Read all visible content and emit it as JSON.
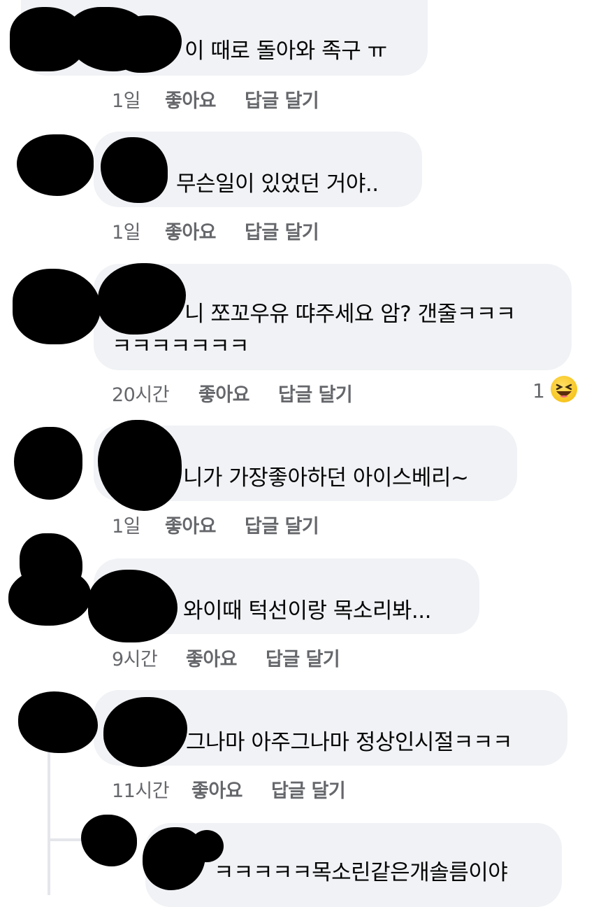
{
  "comments": [
    {
      "text": "이 때로 돌아와 족구 ㅠ",
      "time": "1일",
      "like": "좋아요",
      "reply": "답글 달기"
    },
    {
      "text": "무슨일이 있었던 거야..",
      "time": "1일",
      "like": "좋아요",
      "reply": "답글 달기"
    },
    {
      "text_line1": "니 쪼꼬우유 땨주세요 암? 갠줄ㅋㅋㅋ",
      "text_line2": "ㅋㅋㅋㅋㅋㅋㅋ",
      "time": "20시간",
      "like": "좋아요",
      "reply": "답글 달기",
      "reaction_count": "1",
      "reaction_icon": "laughing-emoji-icon"
    },
    {
      "text": "니가 가장좋아하던 아이스베리~",
      "time": "1일",
      "like": "좋아요",
      "reply": "답글 달기"
    },
    {
      "text": "와이때 턱선이랑 목소리봐...",
      "time": "9시간",
      "like": "좋아요",
      "reply": "답글 달기"
    },
    {
      "text": "그나마 아주그나마 정상인시절ㅋㅋㅋ",
      "time": "11시간",
      "like": "좋아요",
      "reply": "답글 달기"
    },
    {
      "text": "ㅋㅋㅋㅋㅋ목소린같은개솔름이야",
      "is_reply": true
    }
  ],
  "colors": {
    "bubble": "#f0f2f5",
    "meta": "#65676b",
    "mention": "#1877f2",
    "redaction": "#000000"
  }
}
